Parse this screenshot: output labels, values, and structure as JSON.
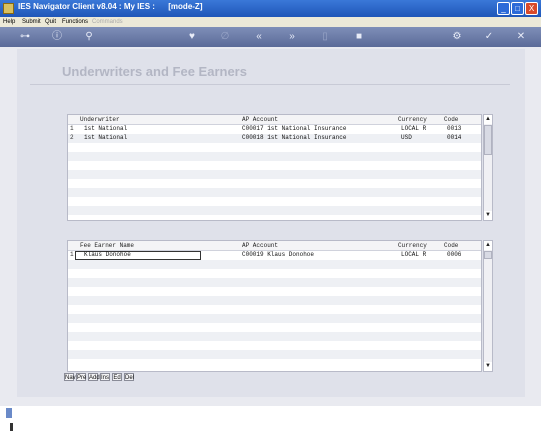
{
  "window": {
    "title": "IES Navigator Client v8.04 : My IES :      [mode-Z]",
    "minimize": "_",
    "maximize": "□",
    "close": "X"
  },
  "menu": {
    "items": [
      "Help",
      "Submit",
      "Quit",
      "Functions",
      "Commands"
    ]
  },
  "toolbar": {
    "icons": [
      "key-icon",
      "info-icon",
      "search-icon",
      "heart-icon",
      "link-icon",
      "rewind-icon",
      "fast-forward-icon",
      "document-icon",
      "delete-icon",
      "settings-icon",
      "confirm-icon",
      "cancel-icon"
    ]
  },
  "page": {
    "title": "Underwriters and Fee Earners"
  },
  "underwriters": {
    "columns": {
      "name": "Underwriter",
      "ap": "AP Account",
      "currency": "Currency",
      "code": "Code"
    },
    "rows": [
      {
        "num": "1",
        "name": "1st National",
        "ap": "C00017 1st National Insurance",
        "currency": "LOCAL R",
        "code": "0013"
      },
      {
        "num": "2",
        "name": "1st National",
        "ap": "C00018 1st National Insurance",
        "currency": "USD",
        "code": "0014"
      }
    ]
  },
  "fee_earners": {
    "columns": {
      "name": "Fee Earner Name",
      "ap": "AP Account",
      "currency": "Currency",
      "code": "Code"
    },
    "rows": [
      {
        "num": "1",
        "name": "Klaus Donohoe",
        "ap": "C00019 Klaus Donohoe",
        "currency": "LOCAL R",
        "code": "0006"
      }
    ]
  },
  "bottom_actions": [
    "Nav",
    "Pre",
    "Add",
    "Ins",
    "Ed",
    "Del"
  ]
}
